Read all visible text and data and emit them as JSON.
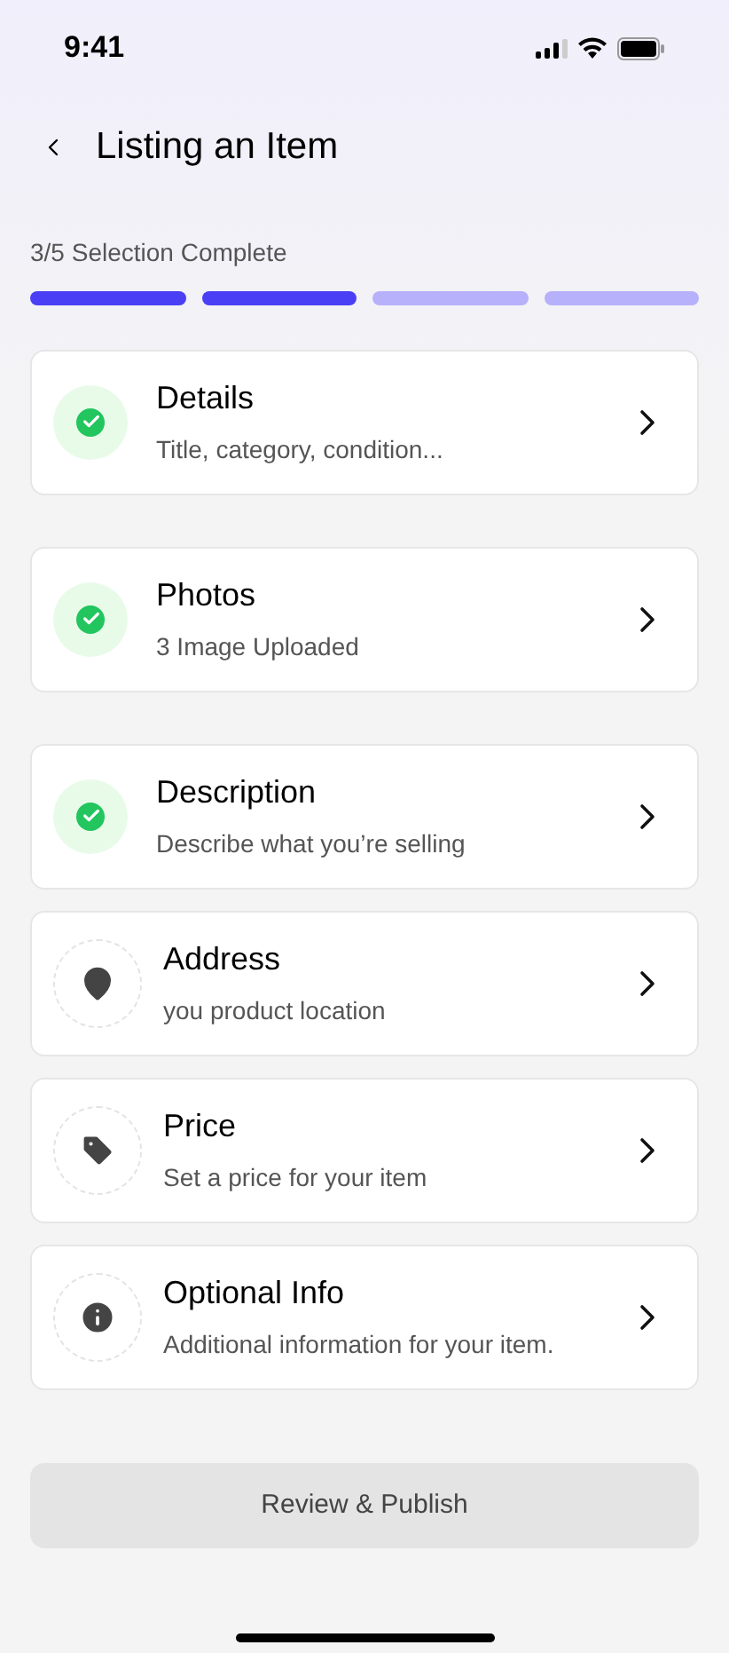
{
  "status_bar": {
    "time": "9:41"
  },
  "header": {
    "title": "Listing an Item"
  },
  "progress": {
    "label": "3/5 Selection Complete",
    "segments": [
      {
        "done": true
      },
      {
        "done": true
      },
      {
        "done": false
      },
      {
        "done": false
      }
    ]
  },
  "steps": [
    {
      "title": "Details",
      "subtitle": "Title, category, condition...",
      "done": true,
      "kind": "check"
    },
    {
      "title": "Photos",
      "subtitle": "3 Image Uploaded",
      "done": true,
      "kind": "check"
    },
    {
      "title": "Description",
      "subtitle": "Describe what you’re selling",
      "done": true,
      "kind": "check"
    },
    {
      "title": "Address",
      "subtitle": "you product location",
      "done": false,
      "kind": "location"
    },
    {
      "title": "Price",
      "subtitle": "Set a price for your item",
      "done": false,
      "kind": "tag"
    },
    {
      "title": "Optional Info",
      "subtitle": "Additional information for your item.",
      "done": false,
      "kind": "info"
    }
  ],
  "action": {
    "label": "Review & Publish",
    "disabled": true
  }
}
